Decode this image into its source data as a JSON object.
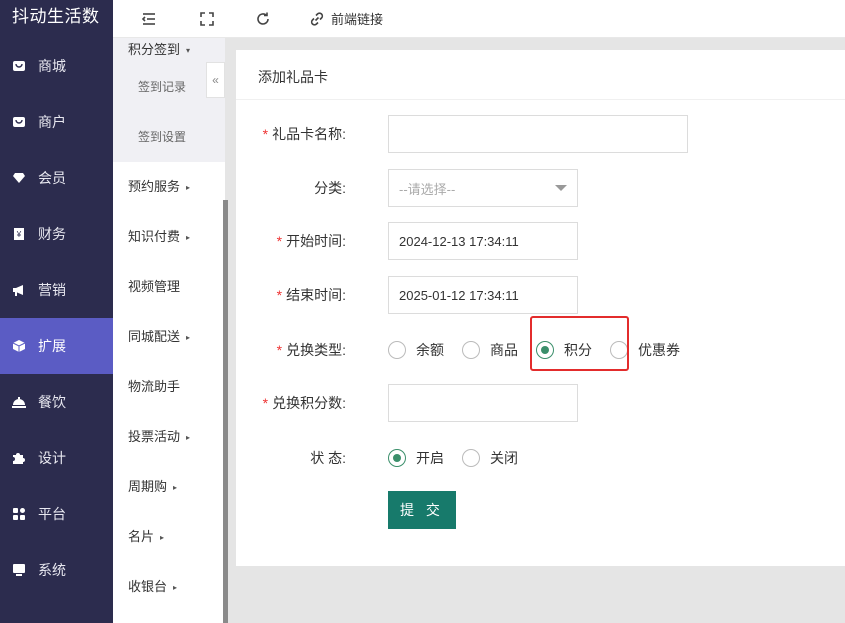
{
  "brand": "抖动生活数",
  "nav": [
    {
      "icon": "store-icon",
      "label": "商城"
    },
    {
      "icon": "merchant-icon",
      "label": "商户"
    },
    {
      "icon": "member-icon",
      "label": "会员"
    },
    {
      "icon": "finance-icon",
      "label": "财务"
    },
    {
      "icon": "megaphone-icon",
      "label": "营销"
    },
    {
      "icon": "cube-icon",
      "label": "扩展",
      "active": true
    },
    {
      "icon": "dining-icon",
      "label": "餐饮"
    },
    {
      "icon": "puzzle-icon",
      "label": "设计"
    },
    {
      "icon": "grid-icon",
      "label": "平台"
    },
    {
      "icon": "monitor-icon",
      "label": "系统"
    }
  ],
  "submenu": {
    "group_title": "积分签到",
    "children": [
      "签到记录",
      "签到设置"
    ],
    "items": [
      "预约服务",
      "知识付费",
      "视频管理",
      "同城配送",
      "物流助手",
      "投票活动",
      "周期购",
      "名片",
      "收银台"
    ]
  },
  "toolbar": {
    "link_label": "前端链接"
  },
  "form": {
    "title": "添加礼品卡",
    "name_label": "礼品卡名称:",
    "name_value": "",
    "category_label": "分类:",
    "category_placeholder": "--请选择--",
    "start_label": "开始时间:",
    "start_value": "2024-12-13 17:34:11",
    "end_label": "结束时间:",
    "end_value": "2025-01-12 17:34:11",
    "exchange_type_label": "兑换类型:",
    "exchange_types": [
      "余额",
      "商品",
      "积分",
      "优惠券"
    ],
    "exchange_type_selected": "积分",
    "points_label": "兑换积分数:",
    "points_value": "",
    "status_label": "状 态:",
    "status_options": [
      "开启",
      "关闭"
    ],
    "status_selected": "开启",
    "submit_label": "提 交"
  },
  "colors": {
    "sidebar_bg": "#2c2c4e",
    "active_nav": "#5b5cc4",
    "primary_button": "#177a6b",
    "radio_checked": "#3b8f6b",
    "highlight_border": "#e32c2c",
    "required": "#e33333"
  }
}
